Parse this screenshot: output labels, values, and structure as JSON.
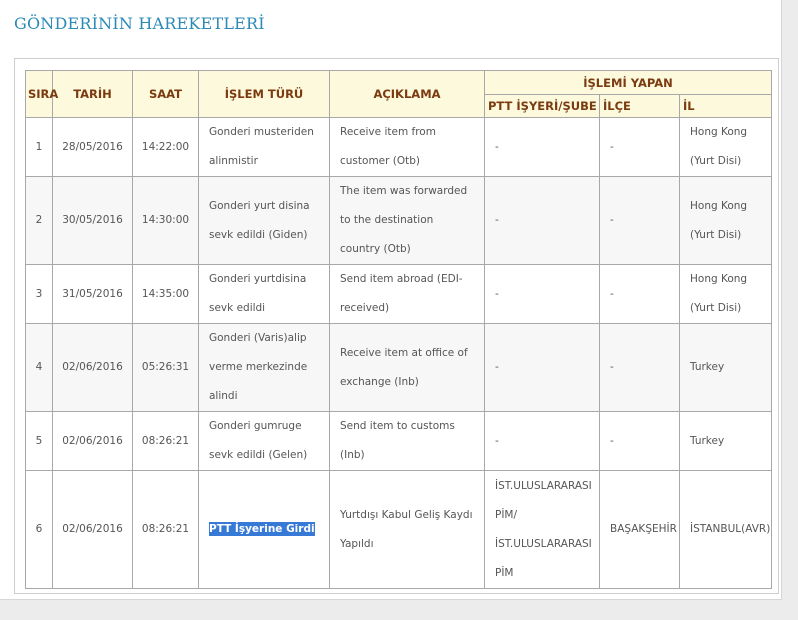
{
  "page_title": "GÖNDERİNİN HAREKETLERİ",
  "headers": {
    "sira": "SIRA",
    "tarih": "TARİH",
    "saat": "SAAT",
    "islem_turu": "İŞLEM TÜRÜ",
    "aciklama": "AÇIKLAMA",
    "islemi_yapan": "İŞLEMİ YAPAN",
    "ptt_isyeri": "PTT İŞYERİ/ŞUBE",
    "ilce": "İLÇE",
    "il": "İL"
  },
  "rows": [
    {
      "sira": "1",
      "tarih": "28/05/2016",
      "saat": "14:22:00",
      "islem_turu": "Gonderi musteriden alinmistir",
      "aciklama": "Receive item from customer (Otb)",
      "ptt_isyeri": "-",
      "ilce": "-",
      "il": "Hong Kong (Yurt Disi)"
    },
    {
      "sira": "2",
      "tarih": "30/05/2016",
      "saat": "14:30:00",
      "islem_turu": "Gonderi yurt disina sevk edildi (Giden)",
      "aciklama": "The item was forwarded to the destination country (Otb)",
      "ptt_isyeri": "-",
      "ilce": "-",
      "il": "Hong Kong (Yurt Disi)"
    },
    {
      "sira": "3",
      "tarih": "31/05/2016",
      "saat": "14:35:00",
      "islem_turu": "Gonderi yurtdisina sevk edildi",
      "aciklama": "Send item abroad (EDI-received)",
      "ptt_isyeri": "-",
      "ilce": "-",
      "il": "Hong Kong (Yurt Disi)"
    },
    {
      "sira": "4",
      "tarih": "02/06/2016",
      "saat": "05:26:31",
      "islem_turu": "Gonderi (Varis)alip verme merkezinde alindi",
      "aciklama": "Receive item at office of exchange (Inb)",
      "ptt_isyeri": "-",
      "ilce": "-",
      "il": "Turkey"
    },
    {
      "sira": "5",
      "tarih": "02/06/2016",
      "saat": "08:26:21",
      "islem_turu": "Gonderi gumruge sevk edildi (Gelen)",
      "aciklama": "Send item to customs (Inb)",
      "ptt_isyeri": "-",
      "ilce": "-",
      "il": "Turkey"
    },
    {
      "sira": "6",
      "tarih": "02/06/2016",
      "saat": "08:26:21",
      "islem_turu": "PTT İşyerine Girdi",
      "aciklama": "Yurtdışı Kabul Geliş Kaydı Yapıldı",
      "ptt_isyeri": "İST.ULUSLARARASI PİM/ İST.ULUSLARARASI PİM",
      "ilce": "BAŞAKŞEHİR",
      "il": "İSTANBUL(AVR)"
    }
  ]
}
